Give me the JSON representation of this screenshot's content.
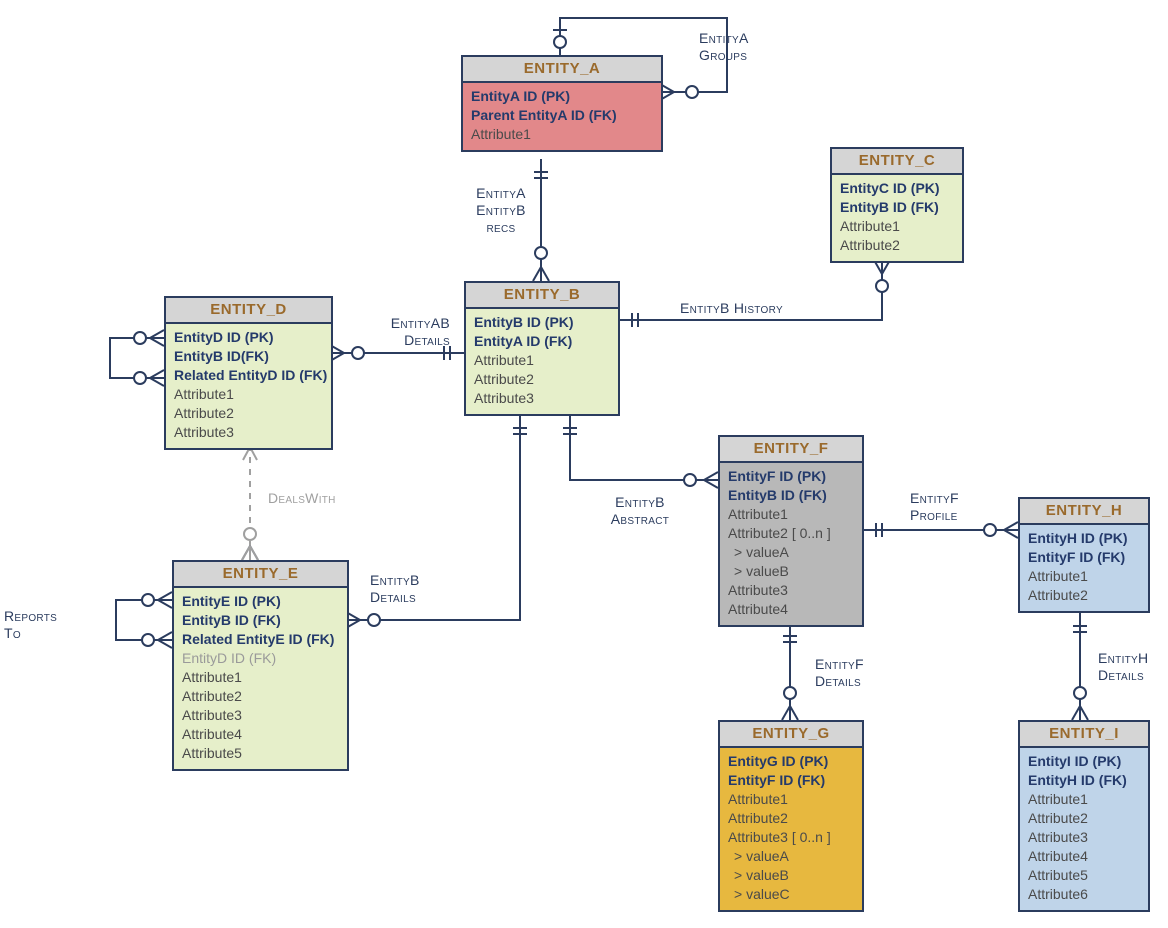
{
  "entities": {
    "A": {
      "title": "ENTITY_A",
      "rows": [
        {
          "t": "EntityA ID (PK)",
          "c": "key"
        },
        {
          "t": "Parent EntityA ID (FK)",
          "c": "key"
        },
        {
          "t": "Attribute1",
          "c": "plain"
        }
      ]
    },
    "B": {
      "title": "ENTITY_B",
      "rows": [
        {
          "t": "EntityB ID (PK)",
          "c": "key"
        },
        {
          "t": "EntityA ID (FK)",
          "c": "key"
        },
        {
          "t": "Attribute1",
          "c": "plain"
        },
        {
          "t": "Attribute2",
          "c": "plain"
        },
        {
          "t": "Attribute3",
          "c": "plain"
        }
      ]
    },
    "C": {
      "title": "ENTITY_C",
      "rows": [
        {
          "t": "EntityC ID (PK)",
          "c": "key"
        },
        {
          "t": "EntityB ID (FK)",
          "c": "key"
        },
        {
          "t": "Attribute1",
          "c": "plain"
        },
        {
          "t": "Attribute2",
          "c": "plain"
        }
      ]
    },
    "D": {
      "title": "ENTITY_D",
      "rows": [
        {
          "t": "EntityD ID (PK)",
          "c": "key"
        },
        {
          "t": "EntityB ID(FK)",
          "c": "key"
        },
        {
          "t": "Related EntityD ID (FK)",
          "c": "key"
        },
        {
          "t": "Attribute1",
          "c": "plain"
        },
        {
          "t": "Attribute2",
          "c": "plain"
        },
        {
          "t": "Attribute3",
          "c": "plain"
        }
      ]
    },
    "E": {
      "title": "ENTITY_E",
      "rows": [
        {
          "t": "EntityE ID (PK)",
          "c": "key"
        },
        {
          "t": "EntityB ID (FK)",
          "c": "key"
        },
        {
          "t": "Related EntityE ID (FK)",
          "c": "key"
        },
        {
          "t": "EntityD ID (FK)",
          "c": "fk-opt"
        },
        {
          "t": "Attribute1",
          "c": "plain"
        },
        {
          "t": "Attribute2",
          "c": "plain"
        },
        {
          "t": "Attribute3",
          "c": "plain"
        },
        {
          "t": "Attribute4",
          "c": "plain"
        },
        {
          "t": "Attribute5",
          "c": "plain"
        }
      ]
    },
    "F": {
      "title": "ENTITY_F",
      "rows": [
        {
          "t": "EntityF ID (PK)",
          "c": "key"
        },
        {
          "t": "EntityB ID (FK)",
          "c": "key"
        },
        {
          "t": "Attribute1",
          "c": "plain"
        },
        {
          "t": "Attribute2 [ 0..n ]",
          "c": "plain"
        },
        {
          "t": " > valueA",
          "c": "sub"
        },
        {
          "t": " > valueB",
          "c": "sub"
        },
        {
          "t": "Attribute3",
          "c": "plain"
        },
        {
          "t": "Attribute4",
          "c": "plain"
        }
      ]
    },
    "G": {
      "title": "ENTITY_G",
      "rows": [
        {
          "t": "EntityG ID (PK)",
          "c": "key"
        },
        {
          "t": "EntityF ID (FK)",
          "c": "key"
        },
        {
          "t": "Attribute1",
          "c": "plain"
        },
        {
          "t": "Attribute2",
          "c": "plain"
        },
        {
          "t": "Attribute3 [ 0..n ]",
          "c": "plain"
        },
        {
          "t": " > valueA",
          "c": "sub"
        },
        {
          "t": " > valueB",
          "c": "sub"
        },
        {
          "t": " > valueC",
          "c": "sub"
        }
      ]
    },
    "H": {
      "title": "ENTITY_H",
      "rows": [
        {
          "t": "EntityH ID (PK)",
          "c": "key"
        },
        {
          "t": "EntityF ID (FK)",
          "c": "key"
        },
        {
          "t": "Attribute1",
          "c": "plain"
        },
        {
          "t": "Attribute2",
          "c": "plain"
        }
      ]
    },
    "I": {
      "title": "ENTITY_I",
      "rows": [
        {
          "t": "EntityI ID (PK)",
          "c": "key"
        },
        {
          "t": "EntityH  ID (FK)",
          "c": "key"
        },
        {
          "t": "Attribute1",
          "c": "plain"
        },
        {
          "t": "Attribute2",
          "c": "plain"
        },
        {
          "t": "Attribute3",
          "c": "plain"
        },
        {
          "t": "Attribute4",
          "c": "plain"
        },
        {
          "t": "Attribute5",
          "c": "plain"
        },
        {
          "t": "Attribute6",
          "c": "plain"
        }
      ]
    }
  },
  "labels": {
    "a_groups": "EntityA\nGroups",
    "a_b_recs": "EntityA\nEntityB\nrecs",
    "ab_details": "EntityAB\nDetails",
    "b_history": "EntityB History",
    "b_details": "EntityB\nDetails",
    "deals_with": "DealsWith",
    "reports_to": "Reports\nTo",
    "b_abstract": "EntityB\nAbstract",
    "f_profile": "EntityF\nProfile",
    "f_details": "EntityF\nDetails",
    "h_details": "EntityH\nDetails"
  }
}
